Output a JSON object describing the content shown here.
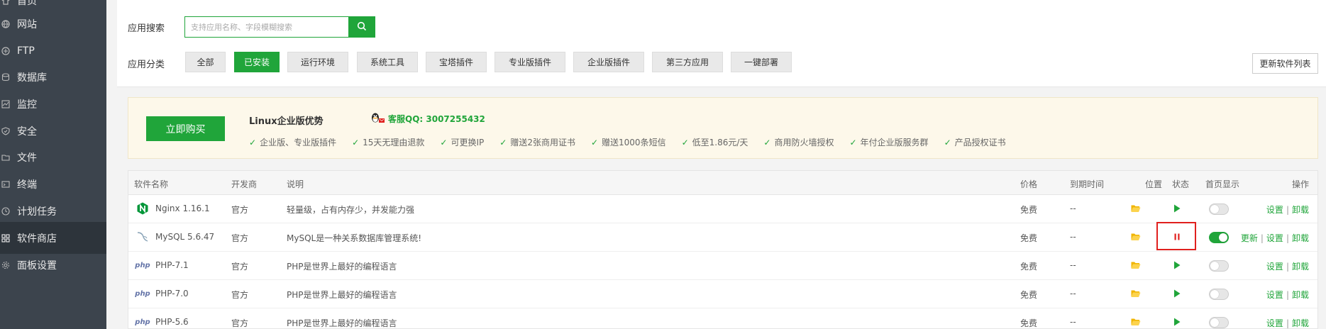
{
  "sidebar": {
    "items": [
      {
        "label": "首页",
        "icon": "home-icon"
      },
      {
        "label": "网站",
        "icon": "globe-icon"
      },
      {
        "label": "FTP",
        "icon": "ftp-icon"
      },
      {
        "label": "数据库",
        "icon": "database-icon"
      },
      {
        "label": "监控",
        "icon": "monitor-icon"
      },
      {
        "label": "安全",
        "icon": "shield-icon"
      },
      {
        "label": "文件",
        "icon": "folder-icon"
      },
      {
        "label": "终端",
        "icon": "terminal-icon"
      },
      {
        "label": "计划任务",
        "icon": "clock-icon"
      },
      {
        "label": "软件商店",
        "icon": "grid-icon"
      },
      {
        "label": "面板设置",
        "icon": "gear-icon"
      }
    ]
  },
  "search": {
    "label": "应用搜索",
    "placeholder": "支持应用名称、字段模糊搜索"
  },
  "categories": {
    "label": "应用分类",
    "items": [
      "全部",
      "已安装",
      "运行环境",
      "系统工具",
      "宝塔插件",
      "专业版插件",
      "企业版插件",
      "第三方应用",
      "一键部署"
    ],
    "active": "已安装"
  },
  "refresh_label": "更新软件列表",
  "promo": {
    "buy_label": "立即购买",
    "title": "Linux企业版优势",
    "qq": "客服QQ: 3007255432",
    "features": [
      "企业版、专业版插件",
      "15天无理由退款",
      "可更换IP",
      "赠送2张商用证书",
      "赠送1000条短信",
      "低至1.86元/天",
      "商用防火墙授权",
      "年付企业版服务群",
      "产品授权证书"
    ]
  },
  "table": {
    "headers": {
      "name": "软件名称",
      "developer": "开发商",
      "desc": "说明",
      "price": "价格",
      "expire": "到期时间",
      "location": "位置",
      "state": "状态",
      "home": "首页显示",
      "ops": "操作"
    },
    "rows": [
      {
        "name": "Nginx 1.16.1",
        "icon": "nginx-icon",
        "developer": "官方",
        "desc": "轻量级，占有内存少，并发能力强",
        "price": "免费",
        "expire": "--",
        "state": "running",
        "home": false,
        "ops": [
          "设置",
          "卸载"
        ]
      },
      {
        "name": "MySQL 5.6.47",
        "icon": "mysql-icon",
        "developer": "官方",
        "desc": "MySQL是一种关系数据库管理系统!",
        "price": "免费",
        "expire": "--",
        "state": "stopped",
        "home": true,
        "ops": [
          "更新",
          "设置",
          "卸载"
        ]
      },
      {
        "name": "PHP-7.1",
        "icon": "php-icon",
        "developer": "官方",
        "desc": "PHP是世界上最好的编程语言",
        "price": "免费",
        "expire": "--",
        "state": "running",
        "home": false,
        "ops": [
          "设置",
          "卸载"
        ]
      },
      {
        "name": "PHP-7.0",
        "icon": "php-icon",
        "developer": "官方",
        "desc": "PHP是世界上最好的编程语言",
        "price": "免费",
        "expire": "--",
        "state": "running",
        "home": false,
        "ops": [
          "设置",
          "卸载"
        ]
      },
      {
        "name": "PHP-5.6",
        "icon": "php-icon",
        "developer": "官方",
        "desc": "PHP是世界上最好的编程语言",
        "price": "免费",
        "expire": "--",
        "state": "running",
        "home": false,
        "ops": [
          "设置",
          "卸载"
        ]
      }
    ]
  },
  "php_logo_text": "php",
  "colors": {
    "accent": "#20a53a",
    "sidebar": "#3c444d",
    "highlight": "#e0201e"
  }
}
